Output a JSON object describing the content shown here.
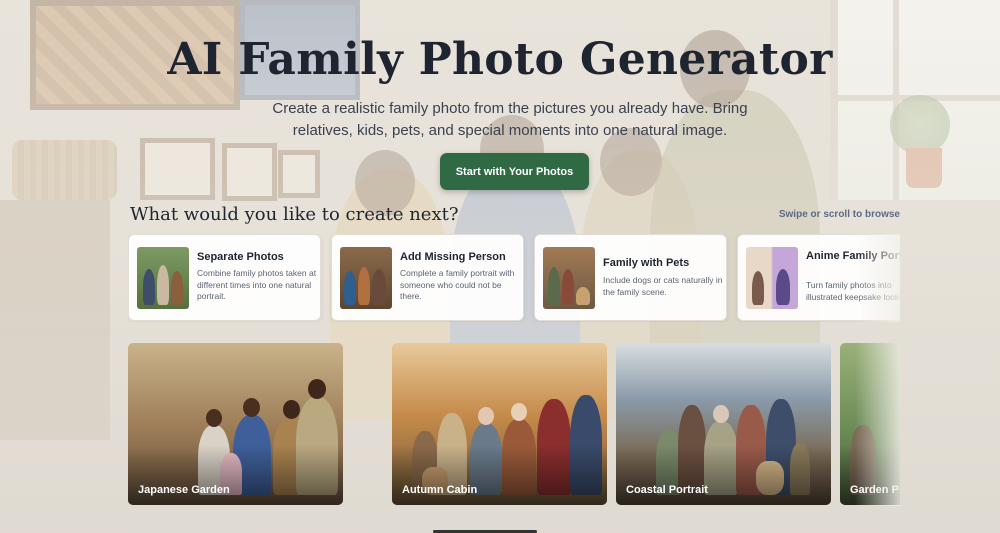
{
  "hero": {
    "title": "AI Family Photo Generator",
    "subtitle": "Create a realistic family photo from the pictures you already have. Bring relatives, kids, pets, and special moments into one natural image.",
    "cta_label": "Start with Your Photos"
  },
  "section": {
    "title": "What would you like to create next?",
    "browse_hint": "Swipe or scroll to browse"
  },
  "options": [
    {
      "title": "Separate Photos",
      "description": "Combine family photos taken at different times into one natural portrait."
    },
    {
      "title": "Add Missing Person",
      "description": "Complete a family portrait with someone who could not be there."
    },
    {
      "title": "Family with Pets",
      "description": "Include dogs or cats naturally in the family scene."
    },
    {
      "title": "Anime Family Portraits",
      "description": "Turn family photos into illustrated keepsake looks."
    }
  ],
  "styles": [
    {
      "label": "Japanese Garden"
    },
    {
      "label": "Autumn Cabin"
    },
    {
      "label": "Coastal Portrait"
    },
    {
      "label": "Garden P"
    }
  ],
  "colors": {
    "accent": "#2f6a45",
    "hint": "#5b6b86"
  }
}
